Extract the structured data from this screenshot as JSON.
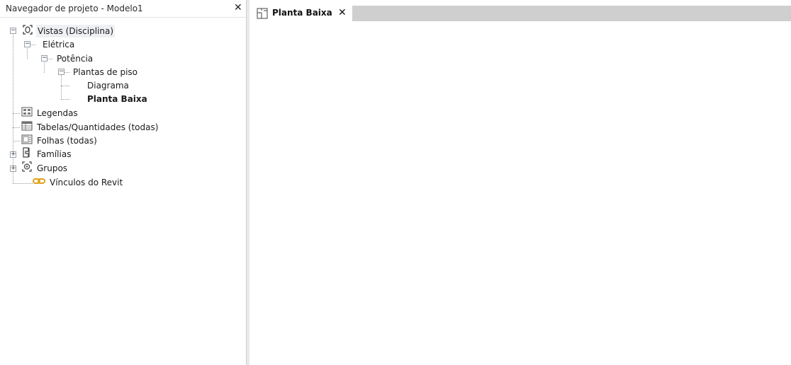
{
  "browser": {
    "title": "Navegador de projeto - Modelo1",
    "close_glyph": "✕",
    "tree": {
      "views": {
        "label": "Vistas (Disciplina)",
        "toggle": "−",
        "icon": "views-icon"
      },
      "eletrica": {
        "label": "Elétrica",
        "toggle": "−"
      },
      "potencia": {
        "label": "Potência",
        "toggle": "−"
      },
      "plantas": {
        "label": "Plantas de piso",
        "toggle": "−"
      },
      "diagrama": {
        "label": "Diagrama"
      },
      "planta_baixa": {
        "label": "Planta Baixa"
      },
      "legendas": {
        "label": "Legendas",
        "icon": "legend-icon"
      },
      "tabelas": {
        "label": "Tabelas/Quantidades (todas)",
        "icon": "schedule-icon"
      },
      "folhas": {
        "label": "Folhas (todas)",
        "icon": "sheet-icon"
      },
      "familias": {
        "label": "Famílias",
        "toggle": "+",
        "icon": "family-icon"
      },
      "grupos": {
        "label": "Grupos",
        "toggle": "+",
        "icon": "group-icon"
      },
      "vinculos": {
        "label": "Vínculos do Revit",
        "icon": "link-icon"
      }
    }
  },
  "tabs": [
    {
      "label": "Planta Baixa",
      "icon": "floor-plan-icon",
      "close_glyph": "✕",
      "active": true
    }
  ],
  "colors": {
    "selection_bg": "#eef0f4",
    "tabstrip_bg": "#cfcfcf",
    "link_icon": "#e0a21b"
  }
}
